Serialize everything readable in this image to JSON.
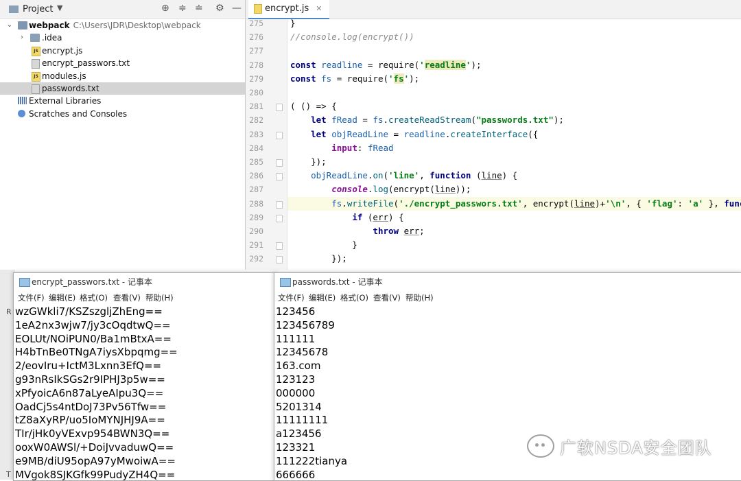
{
  "ide": {
    "project_panel": {
      "title": "Project",
      "tree": [
        {
          "label": "webpack",
          "path": "C:\\Users\\JDR\\Desktop\\webpack",
          "kind": "folder-open",
          "depth": 0,
          "icon": "folder-icon"
        },
        {
          "label": ".idea",
          "kind": "folder",
          "depth": 1,
          "icon": "folder-icon"
        },
        {
          "label": "encrypt.js",
          "kind": "file",
          "depth": 1,
          "icon": "js-file-icon"
        },
        {
          "label": "encrypt_passwors.txt",
          "kind": "file",
          "depth": 1,
          "icon": "text-file-icon"
        },
        {
          "label": "modules.js",
          "kind": "file",
          "depth": 1,
          "icon": "js-file-icon"
        },
        {
          "label": "passwords.txt",
          "kind": "file",
          "depth": 1,
          "icon": "text-file-icon",
          "selected": true
        },
        {
          "label": "External Libraries",
          "kind": "lib",
          "depth": 0,
          "icon": "library-icon"
        },
        {
          "label": "Scratches and Consoles",
          "kind": "scratch",
          "depth": 0,
          "icon": "scratch-icon"
        }
      ]
    },
    "editor": {
      "tab_label": "encrypt.js",
      "current_line": 288,
      "lines": [
        {
          "no": "275",
          "tokens": [
            {
              "t": "}",
              "c": ""
            }
          ]
        },
        {
          "no": "276",
          "tokens": [
            {
              "t": "//console.log(encrypt())",
              "c": "com"
            }
          ]
        },
        {
          "no": "277",
          "tokens": []
        },
        {
          "no": "278",
          "tokens": [
            {
              "t": "const ",
              "c": "kw"
            },
            {
              "t": "readline",
              "c": "var"
            },
            {
              "t": " = require(",
              "c": ""
            },
            {
              "t": "'",
              "c": "str"
            },
            {
              "t": "readline",
              "c": "strbox"
            },
            {
              "t": "'",
              "c": "str"
            },
            {
              "t": ");",
              "c": ""
            }
          ]
        },
        {
          "no": "279",
          "tokens": [
            {
              "t": "const ",
              "c": "kw"
            },
            {
              "t": "fs",
              "c": "var"
            },
            {
              "t": " = require(",
              "c": ""
            },
            {
              "t": "'",
              "c": "str"
            },
            {
              "t": "fs",
              "c": "strbox"
            },
            {
              "t": "'",
              "c": "str"
            },
            {
              "t": ");",
              "c": ""
            }
          ]
        },
        {
          "no": "280",
          "tokens": []
        },
        {
          "no": "281",
          "tokens": [
            {
              "t": "( () => {",
              "c": ""
            }
          ]
        },
        {
          "no": "282",
          "tokens": [
            {
              "t": "    let ",
              "c": "kw"
            },
            {
              "t": "fRead",
              "c": "var"
            },
            {
              "t": " = ",
              "c": ""
            },
            {
              "t": "fs",
              "c": "var"
            },
            {
              "t": ".",
              "c": ""
            },
            {
              "t": "createReadStream",
              "c": "fn"
            },
            {
              "t": "(",
              "c": ""
            },
            {
              "t": "\"passwords.txt\"",
              "c": "str"
            },
            {
              "t": ");",
              "c": ""
            }
          ]
        },
        {
          "no": "283",
          "tokens": [
            {
              "t": "    let ",
              "c": "kw"
            },
            {
              "t": "objReadLine",
              "c": "var"
            },
            {
              "t": " = ",
              "c": ""
            },
            {
              "t": "readline",
              "c": "var"
            },
            {
              "t": ".",
              "c": ""
            },
            {
              "t": "createInterface",
              "c": "fn"
            },
            {
              "t": "({",
              "c": ""
            }
          ]
        },
        {
          "no": "284",
          "tokens": [
            {
              "t": "        ",
              "c": ""
            },
            {
              "t": "input",
              "c": "prop"
            },
            {
              "t": ": ",
              "c": ""
            },
            {
              "t": "fRead",
              "c": "var"
            }
          ]
        },
        {
          "no": "285",
          "tokens": [
            {
              "t": "    });",
              "c": ""
            }
          ]
        },
        {
          "no": "286",
          "tokens": [
            {
              "t": "    ",
              "c": ""
            },
            {
              "t": "objReadLine",
              "c": "var"
            },
            {
              "t": ".",
              "c": ""
            },
            {
              "t": "on",
              "c": "fn"
            },
            {
              "t": "(",
              "c": ""
            },
            {
              "t": "'line'",
              "c": "str"
            },
            {
              "t": ", ",
              "c": ""
            },
            {
              "t": "function ",
              "c": "kw"
            },
            {
              "t": "(",
              "c": ""
            },
            {
              "t": "line",
              "c": "ul"
            },
            {
              "t": ") {",
              "c": ""
            }
          ]
        },
        {
          "no": "287",
          "tokens": [
            {
              "t": "        ",
              "c": ""
            },
            {
              "t": "console",
              "c": "it"
            },
            {
              "t": ".",
              "c": ""
            },
            {
              "t": "log",
              "c": "fn"
            },
            {
              "t": "(encrypt(",
              "c": ""
            },
            {
              "t": "line",
              "c": "ul"
            },
            {
              "t": "));",
              "c": ""
            }
          ]
        },
        {
          "no": "288",
          "tokens": [
            {
              "t": "        ",
              "c": ""
            },
            {
              "t": "fs",
              "c": "var"
            },
            {
              "t": ".",
              "c": ""
            },
            {
              "t": "writeFile",
              "c": "fn"
            },
            {
              "t": "(",
              "c": ""
            },
            {
              "t": "'./encrypt_passwors.txt'",
              "c": "str"
            },
            {
              "t": ", encrypt(",
              "c": ""
            },
            {
              "t": "line",
              "c": "ul"
            },
            {
              "t": ")+",
              "c": ""
            },
            {
              "t": "'\\n'",
              "c": "str"
            },
            {
              "t": ", { ",
              "c": ""
            },
            {
              "t": "'flag'",
              "c": "str"
            },
            {
              "t": ": ",
              "c": ""
            },
            {
              "t": "'a'",
              "c": "str"
            },
            {
              "t": " }, ",
              "c": ""
            },
            {
              "t": "function",
              "c": "kw"
            }
          ]
        },
        {
          "no": "289",
          "tokens": [
            {
              "t": "            ",
              "c": ""
            },
            {
              "t": "if ",
              "c": "kw"
            },
            {
              "t": "(",
              "c": ""
            },
            {
              "t": "err",
              "c": "ul"
            },
            {
              "t": ") {",
              "c": ""
            }
          ]
        },
        {
          "no": "290",
          "tokens": [
            {
              "t": "                ",
              "c": ""
            },
            {
              "t": "throw ",
              "c": "kw"
            },
            {
              "t": "err",
              "c": "ul"
            },
            {
              "t": ";",
              "c": ""
            }
          ]
        },
        {
          "no": "291",
          "tokens": [
            {
              "t": "            }",
              "c": ""
            }
          ]
        },
        {
          "no": "292",
          "tokens": [
            {
              "t": "        });",
              "c": ""
            }
          ]
        }
      ]
    }
  },
  "notepad_left": {
    "title": "encrypt_passwors.txt - 记事本",
    "menu": [
      "文件(F)",
      "编辑(E)",
      "格式(O)",
      "查看(V)",
      "帮助(H)"
    ],
    "lines": [
      "wzGWkli7/KSZszgljZhEng==",
      "1eA2nx3wjw7/jy3cOqdtwQ==",
      "EOLUt/NOiPUN0/Ba1mBtxA==",
      "H4bTnBe0TNgA7iysXbpqmg==",
      "2/eovIru+IctM3Lxnn3EfQ==",
      "g93nRsIkSGs2r9IPHJ3p5w==",
      "xPfyoicA6n87aLyeAIpu3Q==",
      "OadCj5s4ntDoJ73Pv56Tfw==",
      "tZ8aXyRP/uo5IoMYNJHJ9A==",
      "TIr/jHk0yVExvp954BWN3Q==",
      "ooxW0AWSl/+DoiJvvaduwQ==",
      "e9MB/diU95opA97yMwoiwA==",
      "MVgok8SJKGfk99PudyZH4Q=="
    ]
  },
  "notepad_right": {
    "title": "passwords.txt - 记事本",
    "menu": [
      "文件(F)",
      "编辑(E)",
      "格式(O)",
      "查看(V)",
      "帮助(H)"
    ],
    "lines": [
      "123456",
      "123456789",
      "111111",
      "12345678",
      "163.com",
      "123123",
      "000000",
      "5201314",
      "11111111",
      "a123456",
      "123321",
      "111222tianya",
      "666666"
    ]
  },
  "watermark": {
    "text": "广软NSDA安全团队",
    "icon": "wechat-icon"
  },
  "background_strip_letters": [
    "R",
    "T"
  ]
}
